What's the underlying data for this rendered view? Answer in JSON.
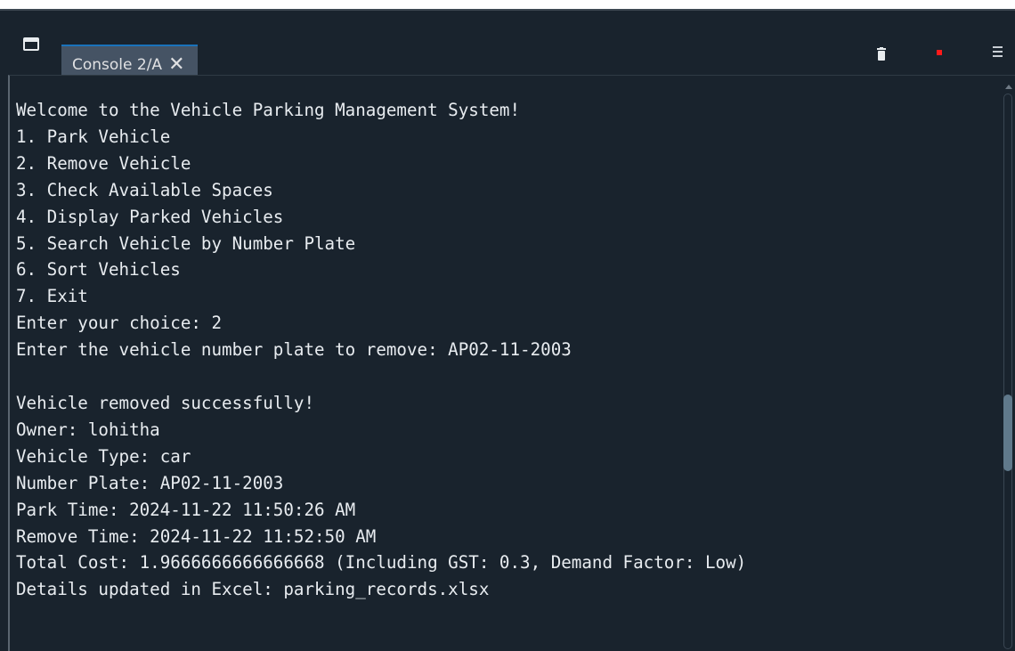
{
  "console_tab": {
    "label": "Console 2/A",
    "close_glyph": "✕"
  },
  "toolbar": {
    "icons": [
      "window-icon",
      "trash-icon",
      "stop-icon",
      "menu-icon"
    ],
    "stop_color": "#ff1a1a"
  },
  "console_output": {
    "lines": [
      "Welcome to the Vehicle Parking Management System!",
      "1. Park Vehicle",
      "2. Remove Vehicle",
      "3. Check Available Spaces",
      "4. Display Parked Vehicles",
      "5. Search Vehicle by Number Plate",
      "6. Sort Vehicles",
      "7. Exit",
      "Enter your choice: 2",
      "Enter the vehicle number plate to remove: AP02-11-2003",
      "",
      "Vehicle removed successfully!",
      "Owner: lohitha",
      "Vehicle Type: car",
      "Number Plate: AP02-11-2003",
      "Park Time: 2024-11-22 11:50:26 AM",
      "Remove Time: 2024-11-22 11:52:50 AM",
      "Total Cost: 1.9666666666666668 (Including GST: 0.3, Demand Factor: Low)",
      "Details updated in Excel: parking_records.xlsx"
    ]
  },
  "theme": {
    "background": "#19232d",
    "tab_background": "#455364",
    "tab_accent": "#1a72bb",
    "text": "#e8ecf0"
  }
}
